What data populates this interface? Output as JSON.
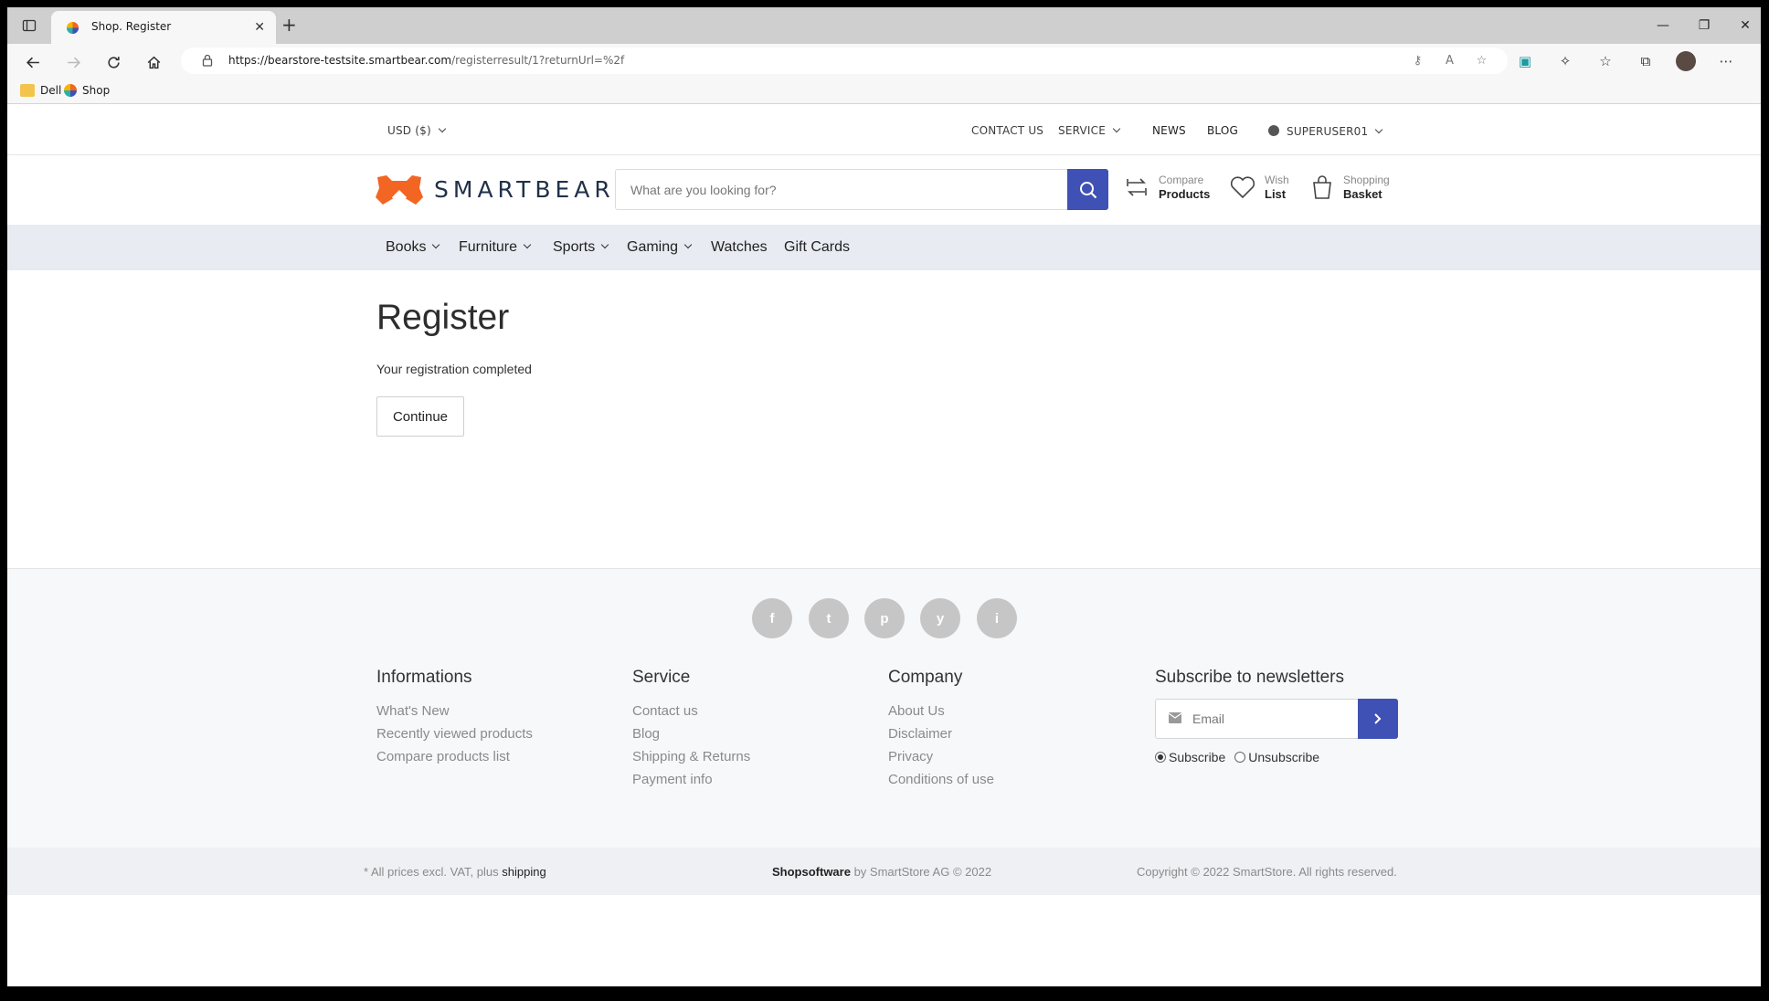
{
  "browser": {
    "tab_title": "Shop. Register",
    "url_domain": "https://bearstore-testsite.smartbear.com",
    "url_path": "/registerresult/1?returnUrl=%2f",
    "bookmarks": [
      "Dell",
      "Shop"
    ]
  },
  "topbar": {
    "currency": "USD  ($)",
    "contact": "CONTACT US",
    "service": "SERVICE",
    "news": "NEWS",
    "blog": "BLOG",
    "user": "SUPERUSER01"
  },
  "header": {
    "logo_text": "SMARTBEAR",
    "search_placeholder": "What are you looking for?",
    "compare_small": "Compare",
    "compare_big": "Products",
    "wish_small": "Wish",
    "wish_big": "List",
    "basket_small": "Shopping",
    "basket_big": "Basket"
  },
  "categories": [
    "Books",
    "Furniture",
    "Sports",
    "Gaming",
    "Watches",
    "Gift Cards"
  ],
  "main": {
    "title": "Register",
    "message": "Your registration completed",
    "continue_label": "Continue"
  },
  "footer": {
    "social": [
      "f",
      "t",
      "p",
      "y",
      "i"
    ],
    "informations": {
      "title": "Informations",
      "links": [
        "What's New",
        "Recently viewed products",
        "Compare products list"
      ]
    },
    "service": {
      "title": "Service",
      "links": [
        "Contact us",
        "Blog",
        "Shipping & Returns",
        "Payment info"
      ]
    },
    "company": {
      "title": "Company",
      "links": [
        "About Us",
        "Disclaimer",
        "Privacy",
        "Conditions of use"
      ]
    },
    "newsletter": {
      "title": "Subscribe to newsletters",
      "placeholder": "Email",
      "subscribe": "Subscribe",
      "unsubscribe": "Unsubscribe"
    }
  },
  "legal": {
    "prices_prefix": "* All prices excl. VAT, plus ",
    "shipping": "shipping",
    "software": "Shopsoftware",
    "by": " by SmartStore AG © 2022",
    "copyright": "Copyright © 2022 SmartStore. All rights reserved."
  },
  "colors": {
    "accent": "#3f51b5",
    "logo_orange": "#f26522",
    "nav_bg": "#e8ebf1"
  }
}
